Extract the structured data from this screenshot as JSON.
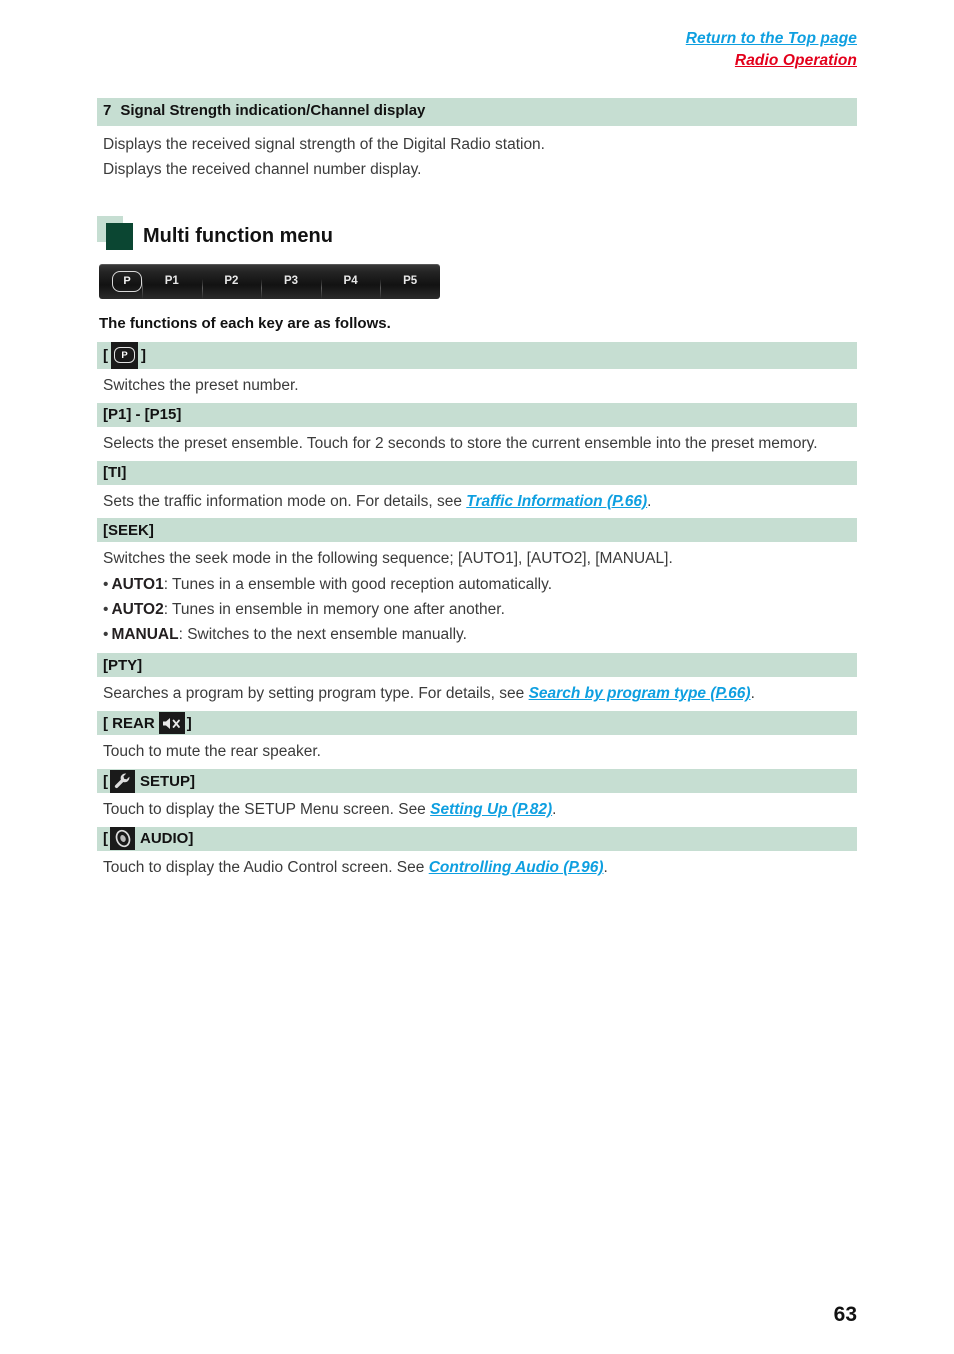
{
  "header": {
    "top_link": "Return to the Top page",
    "section_link": "Radio Operation"
  },
  "section7": {
    "number": "7",
    "title": "Signal Strength indication/Channel display",
    "lines": [
      "Displays the received signal strength of the Digital Radio station.",
      "Displays the received channel number display."
    ]
  },
  "multi_function_menu": {
    "heading": "Multi function menu",
    "device_bar": {
      "preset_key_label": "P",
      "slots": [
        "P1",
        "P2",
        "P3",
        "P4",
        "P5"
      ]
    },
    "intro": "The functions of each key are as follows."
  },
  "keys": {
    "preset": {
      "bracket_open": "[",
      "bracket_close": "]",
      "icon_label": "P",
      "description": "Switches the preset number."
    },
    "p1_p15": {
      "label": "[P1] - [P15]",
      "description": "Selects the preset ensemble. Touch for 2 seconds to store the current ensemble into the preset memory."
    },
    "ti": {
      "label": "[TI]",
      "description_before": "Sets the traffic information mode on. For details, see ",
      "link": "Traffic Information (P.66)",
      "description_after": "."
    },
    "seek": {
      "label": "[SEEK]",
      "description": "Switches the seek mode in the following sequence; [AUTO1], [AUTO2], [MANUAL].",
      "bullet_mark": "•",
      "items": [
        {
          "mode": "AUTO1",
          "text": ": Tunes in a ensemble with good reception automatically."
        },
        {
          "mode": "AUTO2",
          "text": ": Tunes in ensemble in memory one after another."
        },
        {
          "mode": "MANUAL",
          "text": ": Switches to the next ensemble manually."
        }
      ]
    },
    "pty": {
      "label": "[PTY]",
      "description_before": "Searches a program by setting program type. For details, see ",
      "link": "Search by program type (P.66)",
      "description_after": "."
    },
    "rear": {
      "bracket_open": "[",
      "text": "REAR",
      "bracket_close": "]",
      "icon": "speaker-mute-icon",
      "description": "Touch to mute the rear speaker."
    },
    "setup": {
      "bracket_open": "[",
      "text": "SETUP]",
      "icon": "wrench-icon",
      "description_before": "Touch to display the SETUP Menu screen. See ",
      "link": "Setting Up (P.82)",
      "description_after": "."
    },
    "audio": {
      "bracket_open": "[",
      "text": "AUDIO]",
      "icon": "audio-knob-icon",
      "description_before": "Touch to display the Audio Control screen. See ",
      "link": "Controlling Audio (P.96)",
      "description_after": "."
    }
  },
  "footer": {
    "page_number": "63"
  },
  "colors": {
    "bar_green": "#c6ded2",
    "dark_green": "#0b4632",
    "link_blue": "#0e9fe0",
    "section_red": "#e3001b"
  }
}
